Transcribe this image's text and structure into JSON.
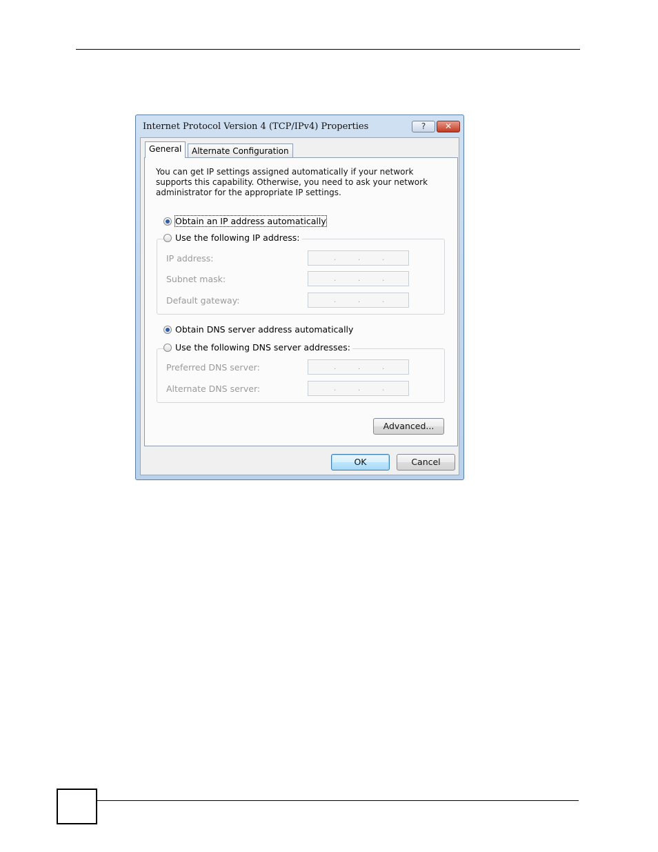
{
  "dialog": {
    "title": "Internet Protocol Version 4 (TCP/IPv4) Properties",
    "help_glyph": "?",
    "close_glyph": "✕"
  },
  "tabs": [
    {
      "label": "General",
      "selected": true
    },
    {
      "label": "Alternate Configuration",
      "selected": false
    }
  ],
  "general": {
    "intro": "You can get IP settings assigned automatically if your network supports this capability. Otherwise, you need to ask your network administrator for the appropriate IP settings.",
    "ip_auto_label": "Obtain an IP address automatically",
    "ip_manual_label": "Use the following IP address:",
    "ip_mode": "automatic",
    "ip_fields": [
      {
        "label": "IP address:",
        "value": ""
      },
      {
        "label": "Subnet mask:",
        "value": ""
      },
      {
        "label": "Default gateway:",
        "value": ""
      }
    ],
    "dns_auto_label": "Obtain DNS server address automatically",
    "dns_manual_label": "Use the following DNS server addresses:",
    "dns_mode": "automatic",
    "dns_fields": [
      {
        "label": "Preferred DNS server:",
        "value": ""
      },
      {
        "label": "Alternate DNS server:",
        "value": ""
      }
    ],
    "advanced_label": "Advanced..."
  },
  "buttons": {
    "ok_label": "OK",
    "cancel_label": "Cancel"
  }
}
